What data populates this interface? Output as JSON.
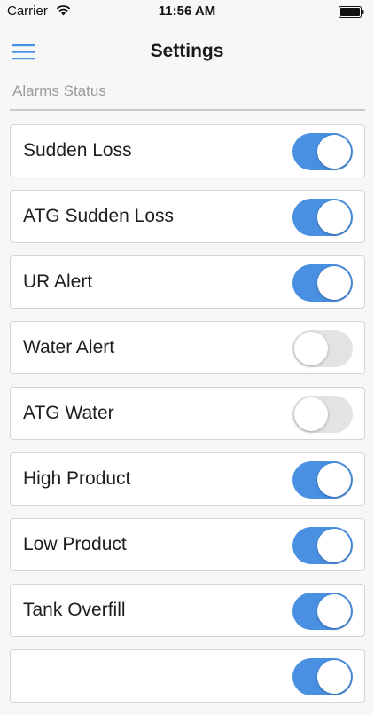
{
  "status_bar": {
    "carrier": "Carrier",
    "time": "11:56 AM",
    "wifi_icon": "wifi-icon",
    "battery_icon": "battery-full-icon"
  },
  "nav": {
    "title": "Settings",
    "menu_icon": "hamburger-menu-icon"
  },
  "section": {
    "header": "Alarms Status"
  },
  "alarms": [
    {
      "label": "Sudden Loss",
      "enabled": true
    },
    {
      "label": "ATG Sudden Loss",
      "enabled": true
    },
    {
      "label": "UR Alert",
      "enabled": true
    },
    {
      "label": "Water Alert",
      "enabled": false
    },
    {
      "label": "ATG Water",
      "enabled": false
    },
    {
      "label": "High Product",
      "enabled": true
    },
    {
      "label": "Low Product",
      "enabled": true
    },
    {
      "label": "Tank Overfill",
      "enabled": true
    },
    {
      "label": "",
      "enabled": true
    }
  ],
  "colors": {
    "accent": "#4a90e2",
    "switch_off": "#e3e3e3",
    "section_header": "#9b9b9b",
    "background": "#f7f7f7"
  }
}
